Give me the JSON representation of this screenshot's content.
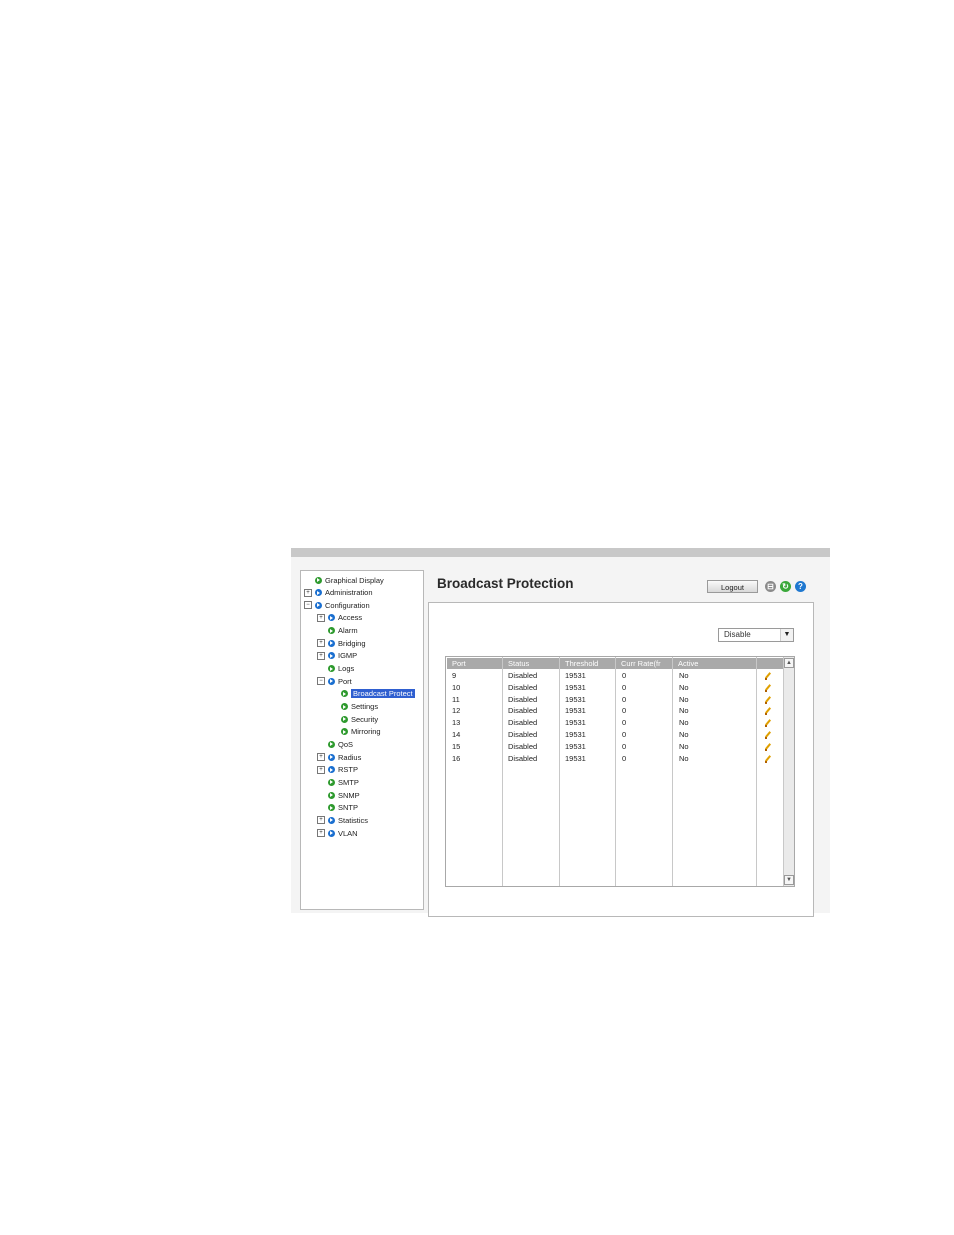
{
  "header": {
    "title": "Broadcast Protection",
    "logout_label": "Logout"
  },
  "toolbar_icons": [
    "save-icon",
    "refresh-icon",
    "help-icon"
  ],
  "tree": [
    {
      "label": "Graphical Display",
      "level": 0,
      "expander": "",
      "dot": "green"
    },
    {
      "label": "Administration",
      "level": 0,
      "expander": "+",
      "dot": "blue"
    },
    {
      "label": "Configuration",
      "level": 0,
      "expander": "−",
      "dot": "blue"
    },
    {
      "label": "Access",
      "level": 1,
      "expander": "+",
      "dot": "blue"
    },
    {
      "label": "Alarm",
      "level": 1,
      "expander": "",
      "dot": "green"
    },
    {
      "label": "Bridging",
      "level": 1,
      "expander": "+",
      "dot": "blue"
    },
    {
      "label": "IGMP",
      "level": 1,
      "expander": "+",
      "dot": "blue"
    },
    {
      "label": "Logs",
      "level": 1,
      "expander": "",
      "dot": "green"
    },
    {
      "label": "Port",
      "level": 1,
      "expander": "−",
      "dot": "blue"
    },
    {
      "label": "Broadcast Protect",
      "level": 2,
      "expander": "",
      "dot": "green",
      "selected": true
    },
    {
      "label": "Settings",
      "level": 2,
      "expander": "",
      "dot": "green"
    },
    {
      "label": "Security",
      "level": 2,
      "expander": "",
      "dot": "green"
    },
    {
      "label": "Mirroring",
      "level": 2,
      "expander": "",
      "dot": "green"
    },
    {
      "label": "QoS",
      "level": 1,
      "expander": "",
      "dot": "green"
    },
    {
      "label": "Radius",
      "level": 1,
      "expander": "+",
      "dot": "blue"
    },
    {
      "label": "RSTP",
      "level": 1,
      "expander": "+",
      "dot": "blue"
    },
    {
      "label": "SMTP",
      "level": 1,
      "expander": "",
      "dot": "green"
    },
    {
      "label": "SNMP",
      "level": 1,
      "expander": "",
      "dot": "green"
    },
    {
      "label": "SNTP",
      "level": 1,
      "expander": "",
      "dot": "green"
    },
    {
      "label": "Statistics",
      "level": 1,
      "expander": "+",
      "dot": "blue"
    },
    {
      "label": "VLAN",
      "level": 1,
      "expander": "+",
      "dot": "blue"
    }
  ],
  "filter": {
    "selected": "Disable"
  },
  "table": {
    "columns": [
      "Port",
      "Status",
      "Threshold",
      "Curr Rate(fr",
      "Active"
    ],
    "rows": [
      [
        "9",
        "Disabled",
        "19531",
        "0",
        "No"
      ],
      [
        "10",
        "Disabled",
        "19531",
        "0",
        "No"
      ],
      [
        "11",
        "Disabled",
        "19531",
        "0",
        "No"
      ],
      [
        "12",
        "Disabled",
        "19531",
        "0",
        "No"
      ],
      [
        "13",
        "Disabled",
        "19531",
        "0",
        "No"
      ],
      [
        "14",
        "Disabled",
        "19531",
        "0",
        "No"
      ],
      [
        "15",
        "Disabled",
        "19531",
        "0",
        "No"
      ],
      [
        "16",
        "Disabled",
        "19531",
        "0",
        "No"
      ]
    ]
  },
  "colors": {
    "green_dot": "#2e9a2e",
    "blue_dot": "#1a6fd0",
    "selection": "#2f5fd0",
    "header_bg": "#a9a9a9"
  }
}
